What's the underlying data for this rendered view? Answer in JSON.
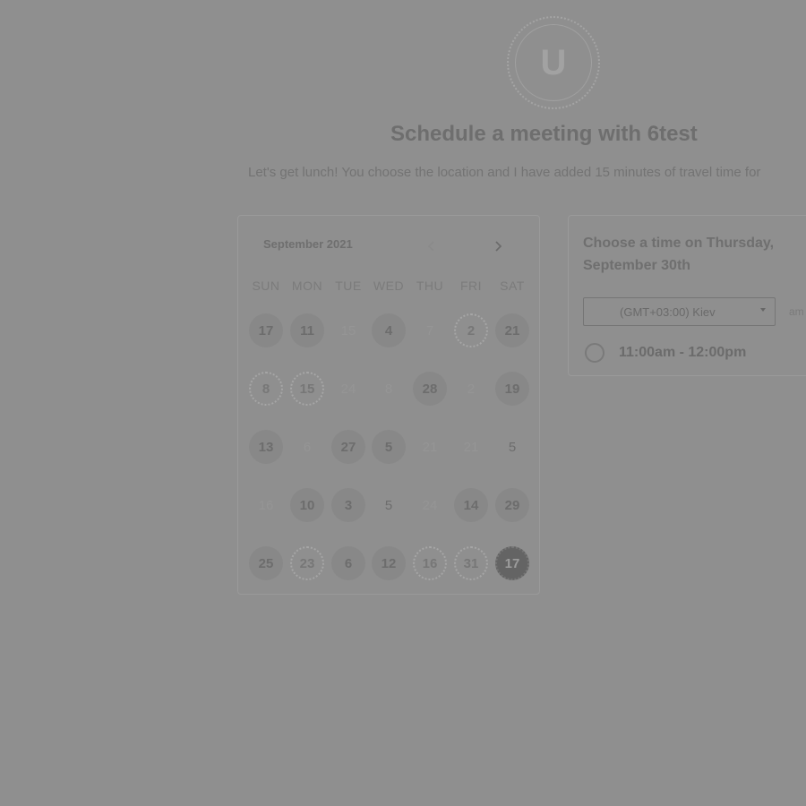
{
  "header": {
    "avatar_letter": "U",
    "title": "Schedule a meeting with 6test",
    "subtitle": "Let's get lunch! You choose the location and I have added 15 minutes of travel time for"
  },
  "calendar": {
    "month_label": "September 2021",
    "prev_icon": "chevron-left-icon",
    "next_icon": "chevron-right-icon",
    "weekdays": [
      "SUN",
      "MON",
      "TUE",
      "WED",
      "THU",
      "FRI",
      "SAT"
    ],
    "weeks": [
      [
        {
          "label": "17",
          "state": "avail"
        },
        {
          "label": "11",
          "state": "avail"
        },
        {
          "label": "15",
          "state": "muted"
        },
        {
          "label": "4",
          "state": "avail"
        },
        {
          "label": "7",
          "state": "muted"
        },
        {
          "label": "2",
          "state": "dotted"
        },
        {
          "label": "21",
          "state": "avail"
        }
      ],
      [
        {
          "label": "8",
          "state": "dotted"
        },
        {
          "label": "15",
          "state": "dotted"
        },
        {
          "label": "24",
          "state": "muted"
        },
        {
          "label": "8",
          "state": "muted"
        },
        {
          "label": "28",
          "state": "avail"
        },
        {
          "label": "2",
          "state": "muted"
        },
        {
          "label": "19",
          "state": "avail"
        }
      ],
      [
        {
          "label": "13",
          "state": "avail"
        },
        {
          "label": "6",
          "state": "muted"
        },
        {
          "label": "27",
          "state": "avail"
        },
        {
          "label": "5",
          "state": "avail"
        },
        {
          "label": "21",
          "state": "muted"
        },
        {
          "label": "21",
          "state": "muted"
        },
        {
          "label": "5",
          "state": "plain"
        }
      ],
      [
        {
          "label": "16",
          "state": "muted"
        },
        {
          "label": "10",
          "state": "avail"
        },
        {
          "label": "3",
          "state": "avail"
        },
        {
          "label": "5",
          "state": "plain"
        },
        {
          "label": "24",
          "state": "muted"
        },
        {
          "label": "14",
          "state": "avail"
        },
        {
          "label": "29",
          "state": "avail"
        }
      ],
      [
        {
          "label": "25",
          "state": "avail"
        },
        {
          "label": "23",
          "state": "dotted"
        },
        {
          "label": "6",
          "state": "avail"
        },
        {
          "label": "12",
          "state": "avail"
        },
        {
          "label": "16",
          "state": "dotted"
        },
        {
          "label": "31",
          "state": "dotted"
        },
        {
          "label": "17",
          "state": "selected"
        }
      ]
    ]
  },
  "times": {
    "heading": "Choose a time on Thursday, September 30th",
    "timezone": "(GMT+03:00) Kiev",
    "format_toggle": "am",
    "slots": [
      {
        "label": "11:00am - 12:00pm"
      }
    ]
  }
}
